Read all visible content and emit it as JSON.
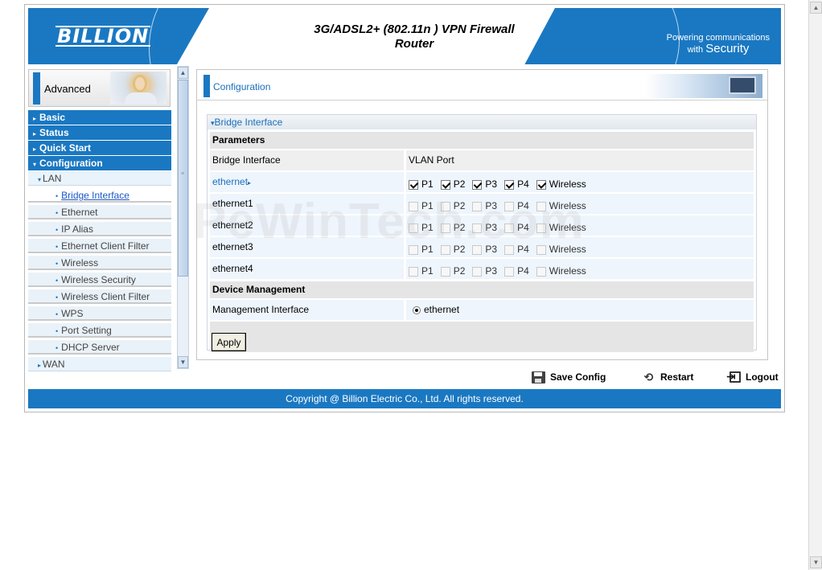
{
  "header": {
    "logo": "BILLION",
    "title_line1": "3G/ADSL2+ (802.11n ) VPN Firewall",
    "title_line2": "Router",
    "tagline_line1": "Powering communications",
    "tagline_line2_small": "with",
    "tagline_line2_big": "Security"
  },
  "sidebar": {
    "mode_label": "Advanced",
    "main_items": [
      {
        "label": "Basic"
      },
      {
        "label": "Status"
      },
      {
        "label": "Quick Start"
      },
      {
        "label": "Configuration"
      }
    ],
    "lan_label": "LAN",
    "lan_items": [
      {
        "label": "Bridge Interface"
      },
      {
        "label": "Ethernet"
      },
      {
        "label": "IP Alias"
      },
      {
        "label": "Ethernet Client Filter"
      },
      {
        "label": "Wireless"
      },
      {
        "label": "Wireless Security"
      },
      {
        "label": "Wireless Client Filter"
      },
      {
        "label": "WPS"
      },
      {
        "label": "Port Setting"
      },
      {
        "label": "DHCP Server"
      }
    ],
    "wan_label": "WAN"
  },
  "content": {
    "heading": "Configuration",
    "panel_title": "Bridge Interface",
    "parameters_label": "Parameters",
    "col1_header": "Bridge Interface",
    "col2_header": "VLAN Port",
    "rows": [
      {
        "name": "ethernet",
        "ports": [
          {
            "label": "P1",
            "checked": true
          },
          {
            "label": "P2",
            "checked": true
          },
          {
            "label": "P3",
            "checked": true
          },
          {
            "label": "P4",
            "checked": true
          },
          {
            "label": "Wireless",
            "checked": true
          }
        ]
      },
      {
        "name": "ethernet1",
        "ports": [
          {
            "label": "P1",
            "checked": false
          },
          {
            "label": "P2",
            "checked": false
          },
          {
            "label": "P3",
            "checked": false
          },
          {
            "label": "P4",
            "checked": false
          },
          {
            "label": "Wireless",
            "checked": false
          }
        ]
      },
      {
        "name": "ethernet2",
        "ports": [
          {
            "label": "P1",
            "checked": false
          },
          {
            "label": "P2",
            "checked": false
          },
          {
            "label": "P3",
            "checked": false
          },
          {
            "label": "P4",
            "checked": false
          },
          {
            "label": "Wireless",
            "checked": false
          }
        ]
      },
      {
        "name": "ethernet3",
        "ports": [
          {
            "label": "P1",
            "checked": false
          },
          {
            "label": "P2",
            "checked": false
          },
          {
            "label": "P3",
            "checked": false
          },
          {
            "label": "P4",
            "checked": false
          },
          {
            "label": "Wireless",
            "checked": false
          }
        ]
      },
      {
        "name": "ethernet4",
        "ports": [
          {
            "label": "P1",
            "checked": false
          },
          {
            "label": "P2",
            "checked": false
          },
          {
            "label": "P3",
            "checked": false
          },
          {
            "label": "P4",
            "checked": false
          },
          {
            "label": "Wireless",
            "checked": false
          }
        ]
      }
    ],
    "device_mgmt_label": "Device Management",
    "mgmt_interface_label": "Management Interface",
    "mgmt_interface_value": "ethernet",
    "apply_label": "Apply"
  },
  "actions": {
    "save": "Save Config",
    "restart": "Restart",
    "logout": "Logout"
  },
  "footer": {
    "copyright": "Copyright @ Billion Electric Co., Ltd. All rights reserved."
  },
  "watermark": "PeWinTech.com",
  "colors": {
    "brand_blue": "#1a78c2",
    "link_blue": "#1a70bc"
  }
}
